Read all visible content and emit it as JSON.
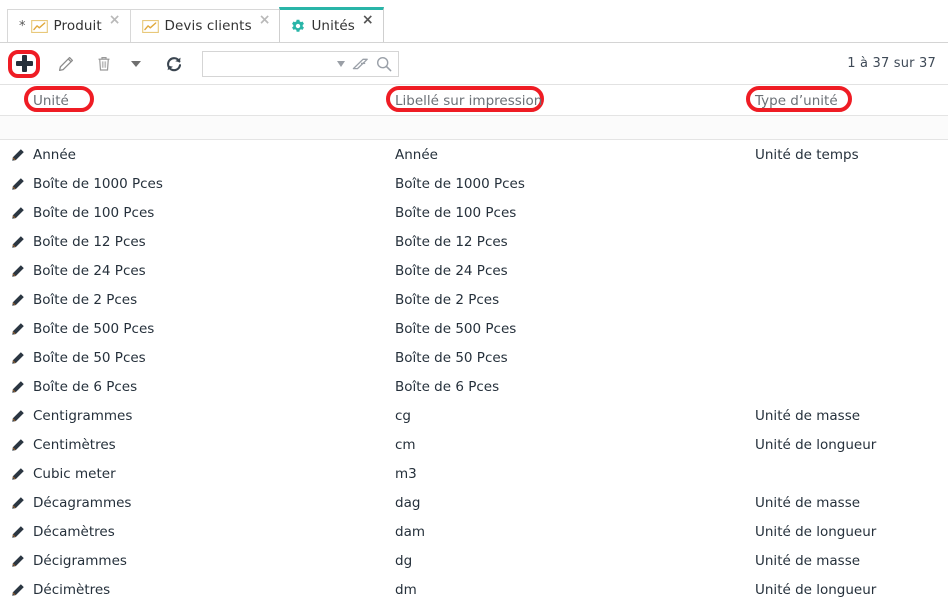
{
  "tabs": [
    {
      "label": "Produit",
      "icon": "chart-line-icon",
      "modified_marker": "*",
      "close": "×",
      "active": false
    },
    {
      "label": "Devis clients",
      "icon": "chart-line-icon",
      "modified_marker": "",
      "close": "×",
      "active": false
    },
    {
      "label": "Unités",
      "icon": "gear-icon",
      "modified_marker": "",
      "close": "×",
      "active": true
    }
  ],
  "toolbar": {
    "add_label": "+",
    "edit_icon": "pencil-icon",
    "delete_icon": "trash-icon",
    "dropdown_icon": "caret-down-icon",
    "refresh_icon": "refresh-icon",
    "search": {
      "value": "",
      "placeholder": "",
      "dropdown_icon": "caret-down-icon",
      "clear_icon": "eraser-icon",
      "search_icon": "search-icon"
    },
    "record_count": "1 à 37 sur 37"
  },
  "accent_color": "#29b5a8",
  "annotation_color": "#ef1c24",
  "grid": {
    "columns": [
      {
        "label": "Unité",
        "highlighted": true
      },
      {
        "label": "Libellé sur impression",
        "highlighted": true
      },
      {
        "label": "Type d’unité",
        "highlighted": true
      }
    ],
    "rows": [
      {
        "edit_icon": "pencil-icon",
        "unite": "Année",
        "libelle": "Année",
        "type": "Unité de temps"
      },
      {
        "edit_icon": "pencil-icon",
        "unite": "Boîte de 1000 Pces",
        "libelle": "Boîte de 1000 Pces",
        "type": ""
      },
      {
        "edit_icon": "pencil-icon",
        "unite": "Boîte de 100 Pces",
        "libelle": "Boîte de 100 Pces",
        "type": ""
      },
      {
        "edit_icon": "pencil-icon",
        "unite": "Boîte de 12 Pces",
        "libelle": "Boîte de 12 Pces",
        "type": ""
      },
      {
        "edit_icon": "pencil-icon",
        "unite": "Boîte de 24 Pces",
        "libelle": "Boîte de 24 Pces",
        "type": ""
      },
      {
        "edit_icon": "pencil-icon",
        "unite": "Boîte de 2 Pces",
        "libelle": "Boîte de 2 Pces",
        "type": ""
      },
      {
        "edit_icon": "pencil-icon",
        "unite": "Boîte de 500 Pces",
        "libelle": "Boîte de 500 Pces",
        "type": ""
      },
      {
        "edit_icon": "pencil-icon",
        "unite": "Boîte de 50 Pces",
        "libelle": "Boîte de 50 Pces",
        "type": ""
      },
      {
        "edit_icon": "pencil-icon",
        "unite": "Boîte de 6 Pces",
        "libelle": "Boîte de 6 Pces",
        "type": ""
      },
      {
        "edit_icon": "pencil-icon",
        "unite": "Centigrammes",
        "libelle": "cg",
        "type": "Unité de masse"
      },
      {
        "edit_icon": "pencil-icon",
        "unite": "Centimètres",
        "libelle": "cm",
        "type": "Unité de longueur"
      },
      {
        "edit_icon": "pencil-icon",
        "unite": "Cubic meter",
        "libelle": "m3",
        "type": ""
      },
      {
        "edit_icon": "pencil-icon",
        "unite": "Décagrammes",
        "libelle": "dag",
        "type": "Unité de masse"
      },
      {
        "edit_icon": "pencil-icon",
        "unite": "Décamètres",
        "libelle": "dam",
        "type": "Unité de longueur"
      },
      {
        "edit_icon": "pencil-icon",
        "unite": "Décigrammes",
        "libelle": "dg",
        "type": "Unité de masse"
      },
      {
        "edit_icon": "pencil-icon",
        "unite": "Décimètres",
        "libelle": "dm",
        "type": "Unité de longueur"
      }
    ]
  }
}
